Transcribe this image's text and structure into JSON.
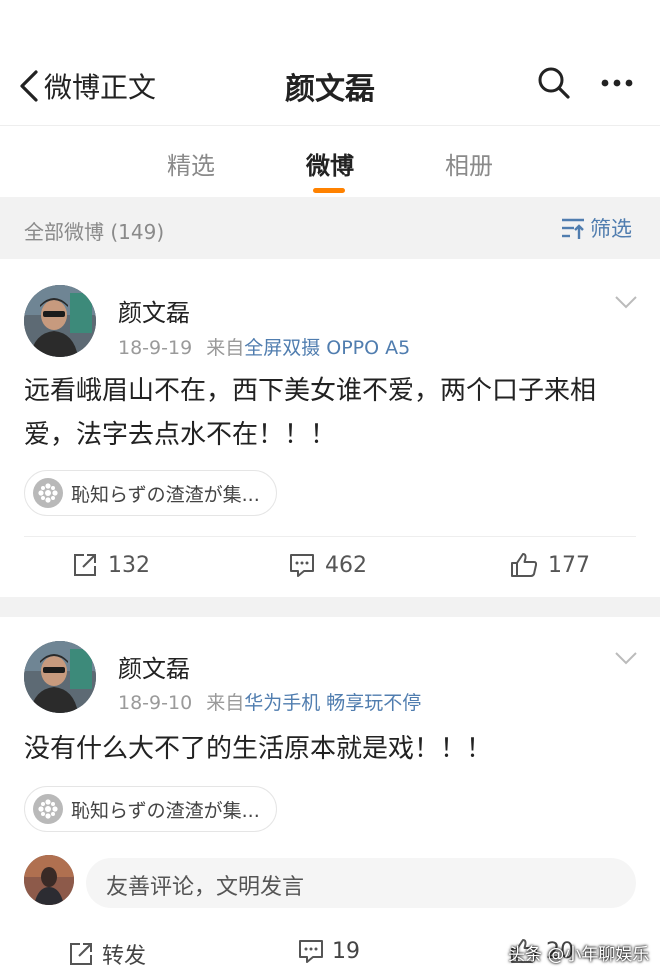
{
  "nav": {
    "back_label": "微博正文",
    "title": "颜文磊"
  },
  "tabs": [
    {
      "label": "精选"
    },
    {
      "label": "微博"
    },
    {
      "label": "相册"
    }
  ],
  "filter": {
    "count_label": "全部微博 (149)",
    "button_label": "筛选"
  },
  "posts": [
    {
      "author": "颜文磊",
      "date": "18-9-19",
      "from_prefix": "来自",
      "source": "全屏双摄 OPPO A5",
      "text": "远看峨眉山不在，西下美女谁不爱，两个口子来相爱，法字去点水不在！！！",
      "topic": "恥知らずの渣渣が集...",
      "reposts": "132",
      "comments": "462",
      "likes": "177"
    },
    {
      "author": "颜文磊",
      "date": "18-9-10",
      "from_prefix": "来自",
      "source": "华为手机 畅享玩不停",
      "text": "没有什么大不了的生活原本就是戏！！！",
      "topic": "恥知らずの渣渣が集..."
    }
  ],
  "comment_box": {
    "placeholder": "友善评论，文明发言"
  },
  "bottom_bar": {
    "repost_label": "转发",
    "comment_count": "19",
    "like_count": "20"
  },
  "watermark": "头条 @小年聊娱乐",
  "colors": {
    "accent": "#ff8200",
    "link": "#507daf",
    "muted": "#9a9a9a",
    "divider_bg": "#f2f2f2"
  },
  "icons": [
    "back-arrow-icon",
    "search-icon",
    "more-icon",
    "filter-icon",
    "chevron-down-icon",
    "topic-icon",
    "repost-icon",
    "comment-icon",
    "like-icon"
  ]
}
